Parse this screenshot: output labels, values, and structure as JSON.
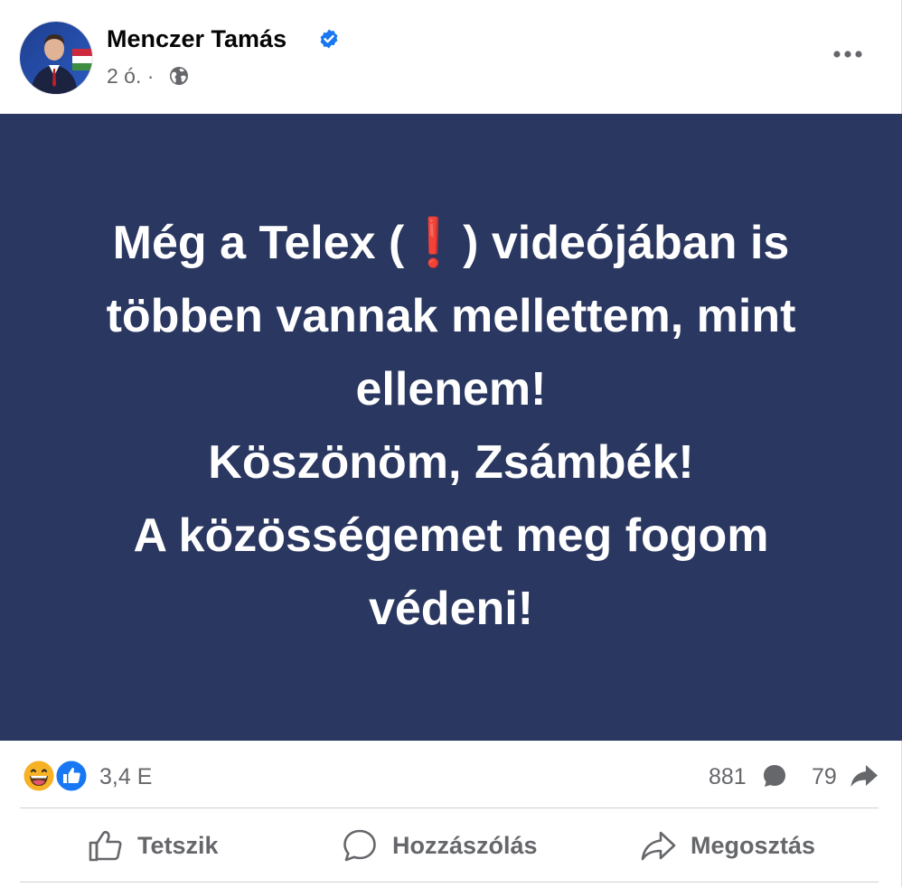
{
  "post": {
    "author": "Menczer Tamás",
    "time": "2 ó. ·",
    "content_lines": [
      {
        "before": "Még a Telex (",
        "emoji": "❗",
        "after": ") videójában is"
      },
      {
        "text": "többen vannak mellettem, mint"
      },
      {
        "text": "ellenem!"
      },
      {
        "text": "Köszönöm, Zsámbék!"
      },
      {
        "text": "A közösségemet meg fogom"
      },
      {
        "text": "védeni!"
      }
    ]
  },
  "stats": {
    "reactions": "3,4 E",
    "comments": "881",
    "shares": "79"
  },
  "actions": {
    "like": "Tetszik",
    "comment": "Hozzászólás",
    "share": "Megosztás"
  },
  "colors": {
    "content_bg": "#2a3760",
    "text_secondary": "#65676b",
    "verified_blue": "#1877f2",
    "like_blue": "#1877f2",
    "haha_yellow": "#f7b125"
  },
  "icons": [
    "verified-badge-icon",
    "globe-icon",
    "more-options-icon",
    "haha-reaction-icon",
    "like-reaction-icon",
    "comment-icon",
    "share-icon",
    "thumbs-up-icon"
  ]
}
